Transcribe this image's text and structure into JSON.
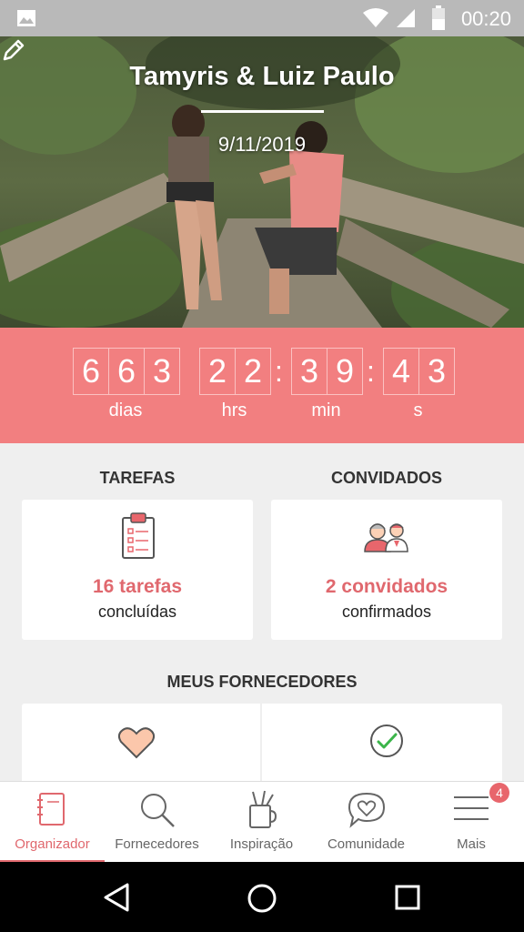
{
  "status_bar": {
    "time": "00:20"
  },
  "hero": {
    "couple": "Tamyris & Luiz Paulo",
    "date": "9/11/2019"
  },
  "countdown": {
    "days": [
      "6",
      "6",
      "3"
    ],
    "hours": [
      "2",
      "2"
    ],
    "minutes": [
      "3",
      "9"
    ],
    "seconds": [
      "4",
      "3"
    ],
    "labels": {
      "days": "dias",
      "hours": "hrs",
      "minutes": "min",
      "seconds": "s"
    }
  },
  "tasks": {
    "title": "TAREFAS",
    "count": "16 tarefas",
    "subtitle": "concluídas"
  },
  "guests": {
    "title": "CONVIDADOS",
    "count": "2 convidados",
    "subtitle": "confirmados"
  },
  "vendors": {
    "title": "MEUS FORNECEDORES"
  },
  "tabbar": {
    "tabs": [
      {
        "label": "Organizador",
        "icon": "notebook-icon",
        "active": true
      },
      {
        "label": "Fornecedores",
        "icon": "search-icon",
        "active": false
      },
      {
        "label": "Inspiração",
        "icon": "brush-cup-icon",
        "active": false
      },
      {
        "label": "Comunidade",
        "icon": "heart-chat-icon",
        "active": false
      },
      {
        "label": "Mais",
        "icon": "menu-icon",
        "active": false
      }
    ],
    "badge": "4"
  },
  "colors": {
    "accent": "#e0686e",
    "countdown_bg": "#f27f80",
    "status_bar": "#b9b9b9"
  }
}
